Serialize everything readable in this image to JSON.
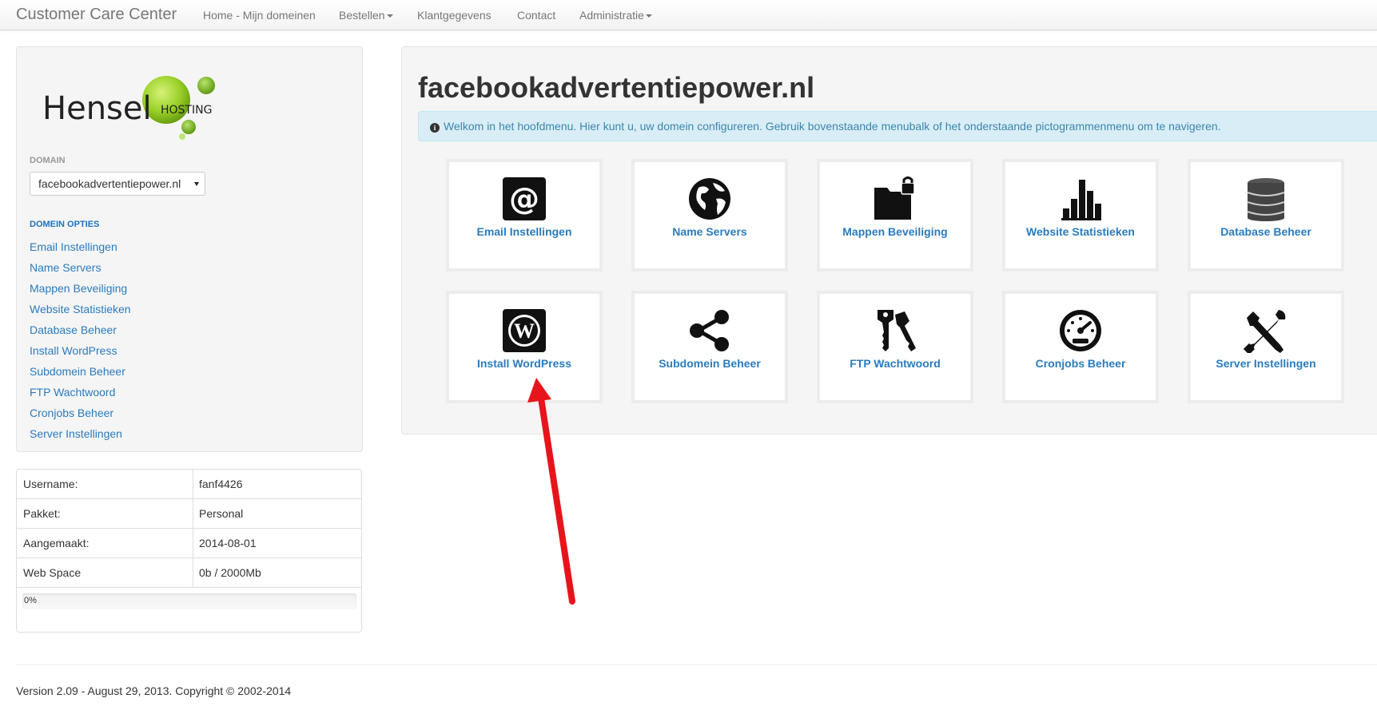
{
  "navbar": {
    "brand": "Customer Care Center",
    "items": [
      {
        "label": "Home - Mijn domeinen",
        "dropdown": false
      },
      {
        "label": "Bestellen",
        "dropdown": true
      },
      {
        "label": "Klantgegevens",
        "dropdown": false
      },
      {
        "label": "Contact",
        "dropdown": false
      },
      {
        "label": "Administratie",
        "dropdown": true
      }
    ]
  },
  "sidebar": {
    "logo": {
      "text": "Hensel",
      "sub": "HOSTING"
    },
    "domain_caption": "DOMAIN",
    "domain_selected": "facebookadvertentiepower.nl",
    "options_caption": "DOMEIN OPTIES",
    "links": [
      "Email Instellingen",
      "Name Servers",
      "Mappen Beveiliging",
      "Website Statistieken",
      "Database Beheer",
      "Install WordPress",
      "Subdomein Beheer",
      "FTP Wachtwoord",
      "Cronjobs Beheer",
      "Server Instellingen"
    ]
  },
  "account_info": {
    "rows": [
      {
        "key": "Username:",
        "value": "fanf4426"
      },
      {
        "key": "Pakket:",
        "value": "Personal"
      },
      {
        "key": "Aangemaakt:",
        "value": "2014-08-01"
      },
      {
        "key": "Web Space",
        "value": "0b / 2000Mb"
      }
    ],
    "usage_text": "0%",
    "usage_fraction": 0
  },
  "main": {
    "title": "facebookadvertentiepower.nl",
    "alert": "Welkom in het hoofdmenu. Hier kunt u, uw domein configureren. Gebruik bovenstaande menubalk of het onderstaande pictogrammenmenu om te navigeren.",
    "tiles": [
      {
        "label": "Email Instellingen",
        "icon": "at-sign-icon"
      },
      {
        "label": "Name Servers",
        "icon": "globe-icon"
      },
      {
        "label": "Mappen Beveiliging",
        "icon": "folder-lock-icon"
      },
      {
        "label": "Website Statistieken",
        "icon": "bar-chart-icon"
      },
      {
        "label": "Database Beheer",
        "icon": "database-icon"
      },
      {
        "label": "Install WordPress",
        "icon": "wordpress-icon"
      },
      {
        "label": "Subdomein Beheer",
        "icon": "share-icon"
      },
      {
        "label": "FTP Wachtwoord",
        "icon": "keys-icon"
      },
      {
        "label": "Cronjobs Beheer",
        "icon": "dashboard-icon"
      },
      {
        "label": "Server Instellingen",
        "icon": "wrench-screwdriver-icon"
      }
    ]
  },
  "annotation": {
    "arrow_color": "#e8141b",
    "points_to": "Install WordPress"
  },
  "footer": {
    "text": "Version 2.09 - August 29, 2013. Copyright © 2002-2014"
  },
  "colors": {
    "link": "#2a7bbf",
    "alert_bg": "#d9edf7",
    "alert_text": "#3a87ad",
    "logo_green": "#8cc63f"
  }
}
